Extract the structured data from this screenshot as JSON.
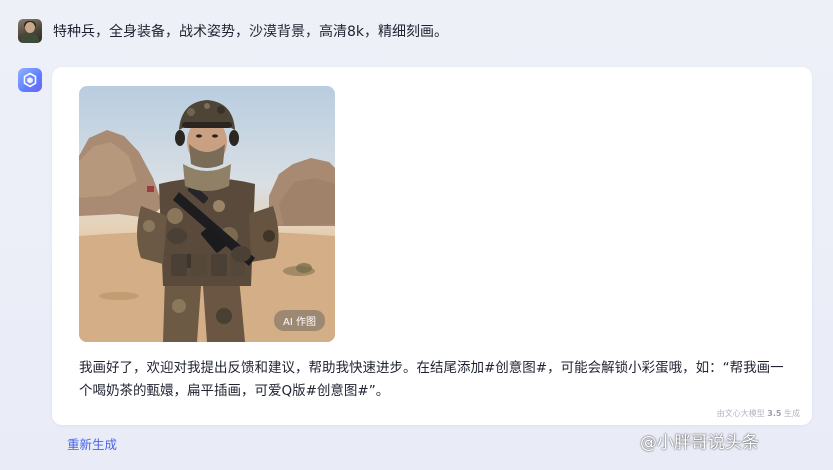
{
  "user_message": {
    "text": "特种兵，全身装备，战术姿势，沙漠背景，高清8k，精细刻画。"
  },
  "assistant_message": {
    "image_badge": "AI 作图",
    "reply_text": "我画好了，欢迎对我提出反馈和建议，帮助我快速进步。在结尾添加#创意图#，可能会解锁小彩蛋哦，如：“帮我画一个喝奶茶的甄嬛，扁平插画，可爱Q版#创意图#”。",
    "footer_prefix": "由文心大模型",
    "footer_version": "3.5",
    "footer_suffix": "生成"
  },
  "actions": {
    "regenerate_label": "重新生成"
  },
  "watermark": {
    "text": "@小胖哥说头条"
  },
  "colors": {
    "page_background": "#eceff8",
    "card_background": "#ffffff",
    "link_blue": "#4a63e8"
  }
}
